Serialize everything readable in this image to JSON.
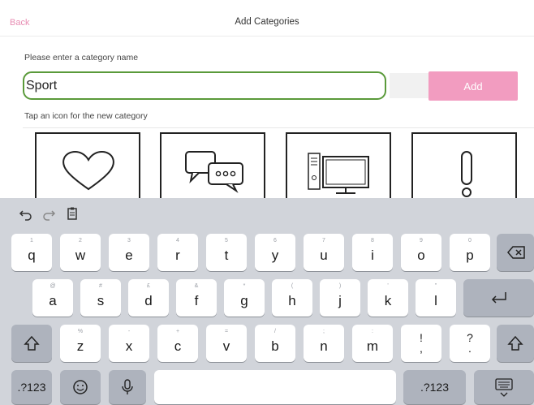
{
  "header": {
    "back_label": "Back",
    "title": "Add Categories"
  },
  "form": {
    "prompt": "Please enter a category name",
    "name_value": "Sport",
    "add_label": "Add",
    "icon_prompt": "Tap an icon for the new category"
  },
  "icons": [
    "heart-icon",
    "speech-bubbles-icon",
    "computer-icon",
    "exclamation-icon"
  ],
  "keyboard": {
    "toolbar": [
      "undo-icon",
      "redo-icon",
      "paste-icon"
    ],
    "row1": [
      {
        "hint": "1",
        "key": "q"
      },
      {
        "hint": "2",
        "key": "w"
      },
      {
        "hint": "3",
        "key": "e"
      },
      {
        "hint": "4",
        "key": "r"
      },
      {
        "hint": "5",
        "key": "t"
      },
      {
        "hint": "6",
        "key": "y"
      },
      {
        "hint": "7",
        "key": "u"
      },
      {
        "hint": "8",
        "key": "i"
      },
      {
        "hint": "9",
        "key": "o"
      },
      {
        "hint": "0",
        "key": "p"
      }
    ],
    "row2": [
      {
        "hint": "@",
        "key": "a"
      },
      {
        "hint": "#",
        "key": "s"
      },
      {
        "hint": "£",
        "key": "d"
      },
      {
        "hint": "&",
        "key": "f"
      },
      {
        "hint": "*",
        "key": "g"
      },
      {
        "hint": "(",
        "key": "h"
      },
      {
        "hint": ")",
        "key": "j"
      },
      {
        "hint": "'",
        "key": "k"
      },
      {
        "hint": "\"",
        "key": "l"
      }
    ],
    "row3": [
      {
        "hint": "%",
        "key": "z"
      },
      {
        "hint": "-",
        "key": "x"
      },
      {
        "hint": "+",
        "key": "c"
      },
      {
        "hint": "=",
        "key": "v"
      },
      {
        "hint": "/",
        "key": "b"
      },
      {
        "hint": ";",
        "key": "n"
      },
      {
        "hint": ":",
        "key": "m"
      },
      {
        "hint": "",
        "key": "!\n,"
      },
      {
        "hint": "",
        "key": "?\n."
      }
    ],
    "numbers_label": ".?123",
    "numbers_label_right": ".?123"
  }
}
